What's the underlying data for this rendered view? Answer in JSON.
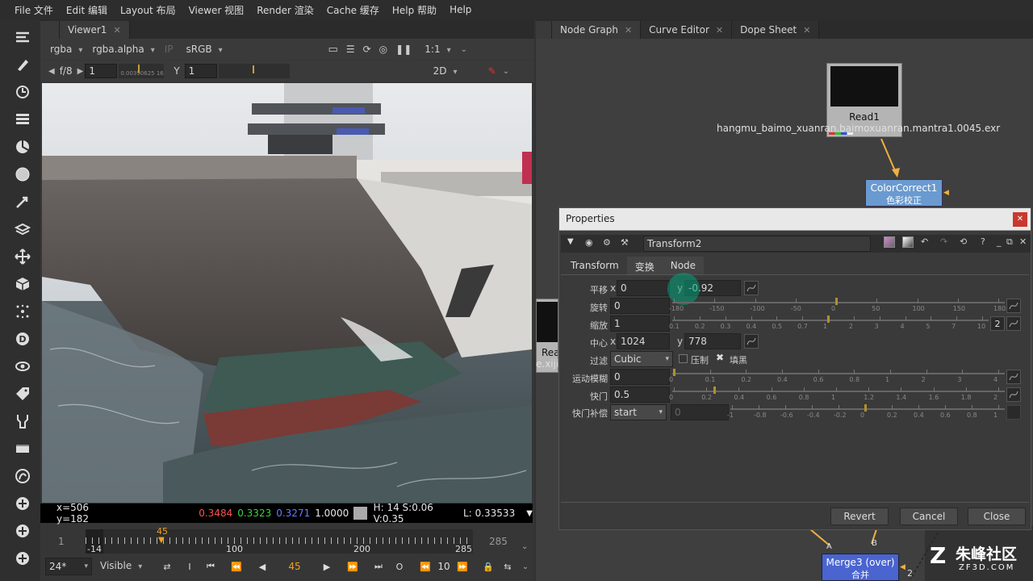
{
  "menu": [
    "File 文件",
    "Edit 编辑",
    "Layout 布局",
    "Viewer 视图",
    "Render 渲染",
    "Cache 缓存",
    "Help 帮助",
    "Help"
  ],
  "viewer": {
    "tab": "Viewer1",
    "channels": "rgba",
    "alpha": "rgba.alpha",
    "ip": "IP",
    "colorspace": "sRGB",
    "zoom": "1:1",
    "fstop": "f/8",
    "gain": "1",
    "gain_slider_label": "0.00390625 164",
    "y_label": "Y",
    "gamma": "1",
    "view_mode": "2D",
    "status": {
      "coords": "x=506 y=182",
      "r": "0.3484",
      "g": "0.3323",
      "b": "0.3271",
      "a": "1.0000",
      "hsv": "H: 14 S:0.06 V:0.35",
      "l": "L: 0.33533"
    },
    "timeline": {
      "in": "1",
      "start": "-14",
      "t100": "100",
      "t200": "200",
      "t285": "285",
      "out": "285",
      "current": "45",
      "fps": "24*",
      "visible": "Visible",
      "frame": "45",
      "step": "10"
    }
  },
  "nodegraph": {
    "tabs": [
      "Node Graph",
      "Curve Editor",
      "Dope Sheet"
    ],
    "read1": {
      "name": "Read1",
      "file": "hangmu_baimo_xuanran.baimoxuanran.mantra1.0045.exr"
    },
    "colorcorrect": {
      "name": "ColorCorrect1",
      "sub": "色彩校正"
    },
    "merge": {
      "name": "Merge3 (over)",
      "sub": "合并"
    },
    "partial_read": "Rea",
    "partial_file": "e.xiji",
    "merge_a": "A",
    "merge_b": "B",
    "num2": "2"
  },
  "properties": {
    "title": "Properties",
    "node_name": "Transform2",
    "tabs": [
      "Transform",
      "变换",
      "Node"
    ],
    "rows": {
      "translate": {
        "label": "平移",
        "x": "0",
        "y": "-0.92"
      },
      "rotate": {
        "label": "旋转",
        "value": "0"
      },
      "scale": {
        "label": "缩放",
        "value": "1"
      },
      "center": {
        "label": "中心",
        "x": "1024",
        "y": "778"
      },
      "filter": {
        "label": "过滤",
        "value": "Cubic",
        "clamp": "压制",
        "black": "填黑"
      },
      "motionblur": {
        "label": "运动模糊",
        "value": "0"
      },
      "shutter": {
        "label": "快门",
        "value": "0.5"
      },
      "shutter_offset": {
        "label": "快门补偿",
        "value": "start",
        "extra": "0"
      }
    },
    "scale_badge": "2",
    "rotate_ticks": [
      "-180",
      "-150",
      "-100",
      "-50",
      "0",
      "50",
      "100",
      "150",
      "180"
    ],
    "scale_ticks": [
      "0.1",
      "0.2",
      "0.3",
      "0.4",
      "0.5",
      "0.7",
      "1",
      "2",
      "3",
      "4",
      "5",
      "7",
      "10"
    ],
    "mb_ticks": [
      "0",
      "0.1",
      "0.2",
      "0.4",
      "0.6",
      "0.8",
      "1",
      "2",
      "3",
      "4"
    ],
    "shutter_ticks": [
      "0",
      "0.2",
      "0.4",
      "0.6",
      "0.8",
      "1",
      "1.2",
      "1.4",
      "1.6",
      "1.8",
      "2"
    ],
    "offset_ticks": [
      "-1",
      "-0.8",
      "-0.6",
      "-0.4",
      "-0.2",
      "0",
      "0.2",
      "0.4",
      "0.6",
      "0.8",
      "1"
    ],
    "buttons": {
      "revert": "Revert",
      "cancel": "Cancel",
      "close": "Close"
    },
    "x_axis": "x",
    "y_axis": "y"
  },
  "watermark": {
    "text": "朱峰社区",
    "sub": "ZF3D.COM"
  }
}
